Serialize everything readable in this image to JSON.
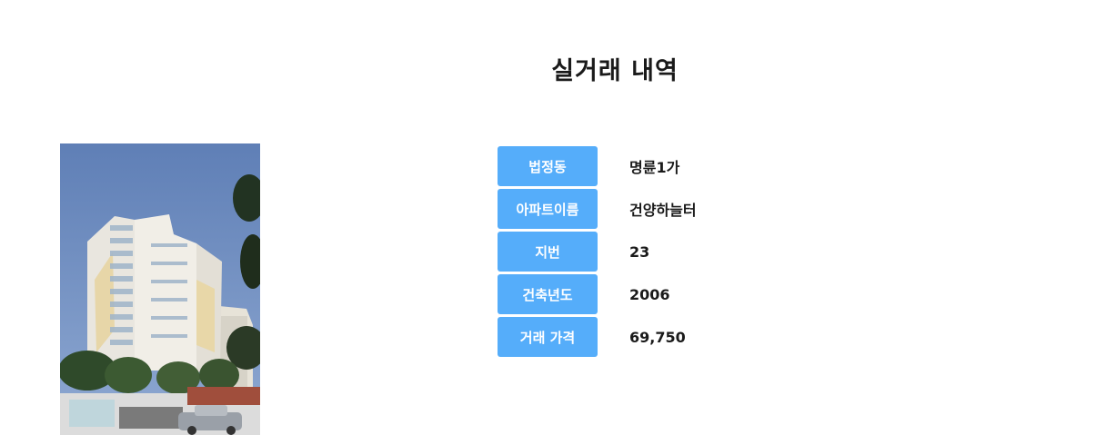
{
  "page": {
    "title": "실거래 내역"
  },
  "photo": {
    "alt": "apartment building photo",
    "sky_color": "#6f8fc4"
  },
  "details": [
    {
      "label": "법정동",
      "value": "명륜1가"
    },
    {
      "label": "아파트이름",
      "value": "건양하늘터"
    },
    {
      "label": "지번",
      "value": "23"
    },
    {
      "label": "건축년도",
      "value": "2006"
    },
    {
      "label": "거래 가격",
      "value": "69,750"
    }
  ],
  "colors": {
    "label_bg": "#55adfa",
    "label_text": "#ffffff",
    "value_text": "#1a1a1a"
  }
}
